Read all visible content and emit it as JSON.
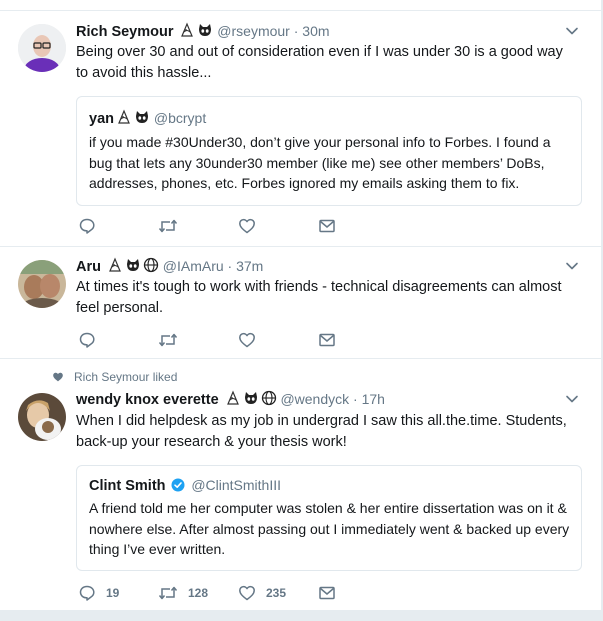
{
  "tweets": [
    {
      "name": "Rich Seymour",
      "handle": "@rseymour",
      "dot": "·",
      "time": "30m",
      "text": "Being over 30 and out of consideration even if I was under 30 is a good way to avoid this hassle...",
      "quote": {
        "name": "yan",
        "handle": "@bcrypt",
        "text": "if you made #30Under30, don’t give your personal info to Forbes. I found a bug that lets any 30under30 member (like me) see other members’ DoBs, addresses, phones, etc. Forbes ignored my emails asking them to fix."
      },
      "actions": {
        "reply": "",
        "retweet": "",
        "like": ""
      }
    },
    {
      "name": "Aru",
      "handle": "@IAmAru",
      "dot": "·",
      "time": "37m",
      "text": "At times it's tough to work with friends - technical disagreements can almost feel personal.",
      "actions": {
        "reply": "",
        "retweet": "",
        "like": ""
      }
    },
    {
      "social_context": "Rich Seymour liked",
      "name": "wendy knox everette",
      "handle": "@wendyck",
      "dot": "·",
      "time": "17h",
      "text": "When I did helpdesk as my job in undergrad I saw this all.the.time. Students, back-up your research & your thesis work!",
      "quote": {
        "name": "Clint Smith",
        "handle": "@ClintSmithIII",
        "text": "A friend told me her computer was stolen & her entire dissertation was on it & nowhere else. After almost passing out I immediately went & backed up every thing I’ve ever written."
      },
      "actions": {
        "reply": "19",
        "retweet": "128",
        "like": "235"
      }
    }
  ],
  "icons": {
    "emoji_1": "rainbow-unicorn-icon",
    "emoji_2": "octocat-icon",
    "emoji_3": "globe-icon",
    "more": "chevron-down-icon",
    "reply": "reply-icon",
    "retweet": "retweet-icon",
    "like": "heart-icon",
    "dm": "envelope-icon",
    "verified": "verified-badge-icon"
  },
  "colors": {
    "accent": "#1da1f2",
    "secondary_text": "#657786",
    "divider": "#e6ecf0"
  }
}
